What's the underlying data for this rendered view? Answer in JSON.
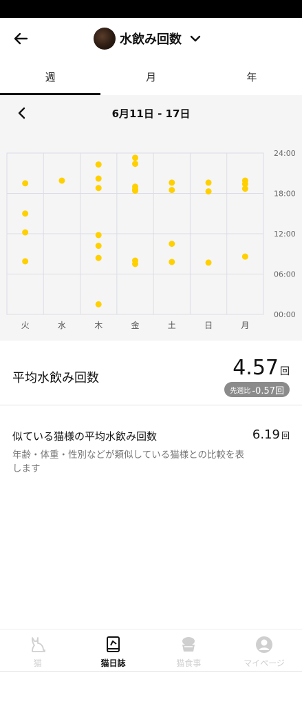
{
  "header": {
    "title": "水飲み回数",
    "back_icon": "arrow-left-icon",
    "dropdown_icon": "chevron-down-icon"
  },
  "tabs": [
    {
      "label": "週",
      "active": true
    },
    {
      "label": "月",
      "active": false
    },
    {
      "label": "年",
      "active": false
    }
  ],
  "week_nav": {
    "label": "6月11日 - 17日",
    "prev_icon": "chevron-left-icon"
  },
  "chart_data": {
    "type": "scatter",
    "categories": [
      "火",
      "水",
      "木",
      "金",
      "土",
      "日",
      "月"
    ],
    "y_ticks": [
      "24:00",
      "18:00",
      "12:00",
      "06:00",
      "00:00"
    ],
    "ylim": [
      0,
      24
    ],
    "grid": true,
    "point_color": "#FFD000",
    "points": [
      {
        "day": "火",
        "hours": [
          19.5,
          15.0,
          12.2,
          7.9
        ]
      },
      {
        "day": "水",
        "hours": [
          19.9
        ]
      },
      {
        "day": "木",
        "hours": [
          22.3,
          20.2,
          18.8,
          11.8,
          10.2,
          8.4,
          1.5
        ]
      },
      {
        "day": "金",
        "hours": [
          23.3,
          22.4,
          19.0,
          18.6,
          18.4,
          8.0,
          7.5
        ]
      },
      {
        "day": "土",
        "hours": [
          19.6,
          18.5,
          10.5,
          7.8
        ]
      },
      {
        "day": "日",
        "hours": [
          19.6,
          18.3,
          7.7
        ]
      },
      {
        "day": "月",
        "hours": [
          19.9,
          19.4,
          18.7,
          8.6
        ]
      }
    ]
  },
  "summary": {
    "avg_label": "平均水飲み回数",
    "avg_value": "4.57",
    "unit": "回",
    "diff_prefix": "先週比",
    "diff_value": "-0.57回"
  },
  "similar": {
    "label": "似ている猫様の平均水飲み回数",
    "value": "6.19",
    "unit": "回",
    "description": "年齢・体重・性別などが類似している猫様との比較を表します"
  },
  "bottom_nav": [
    {
      "label": "猫",
      "icon": "cat-icon",
      "active": false
    },
    {
      "label": "猫日誌",
      "icon": "diary-icon",
      "active": true
    },
    {
      "label": "猫食事",
      "icon": "food-bowl-icon",
      "active": false
    },
    {
      "label": "マイページ",
      "icon": "user-icon",
      "active": false
    }
  ],
  "colors": {
    "accent_yellow": "#FFD000",
    "badge_gray": "#8b8b8b",
    "inactive_gray": "#cfcfcf"
  }
}
